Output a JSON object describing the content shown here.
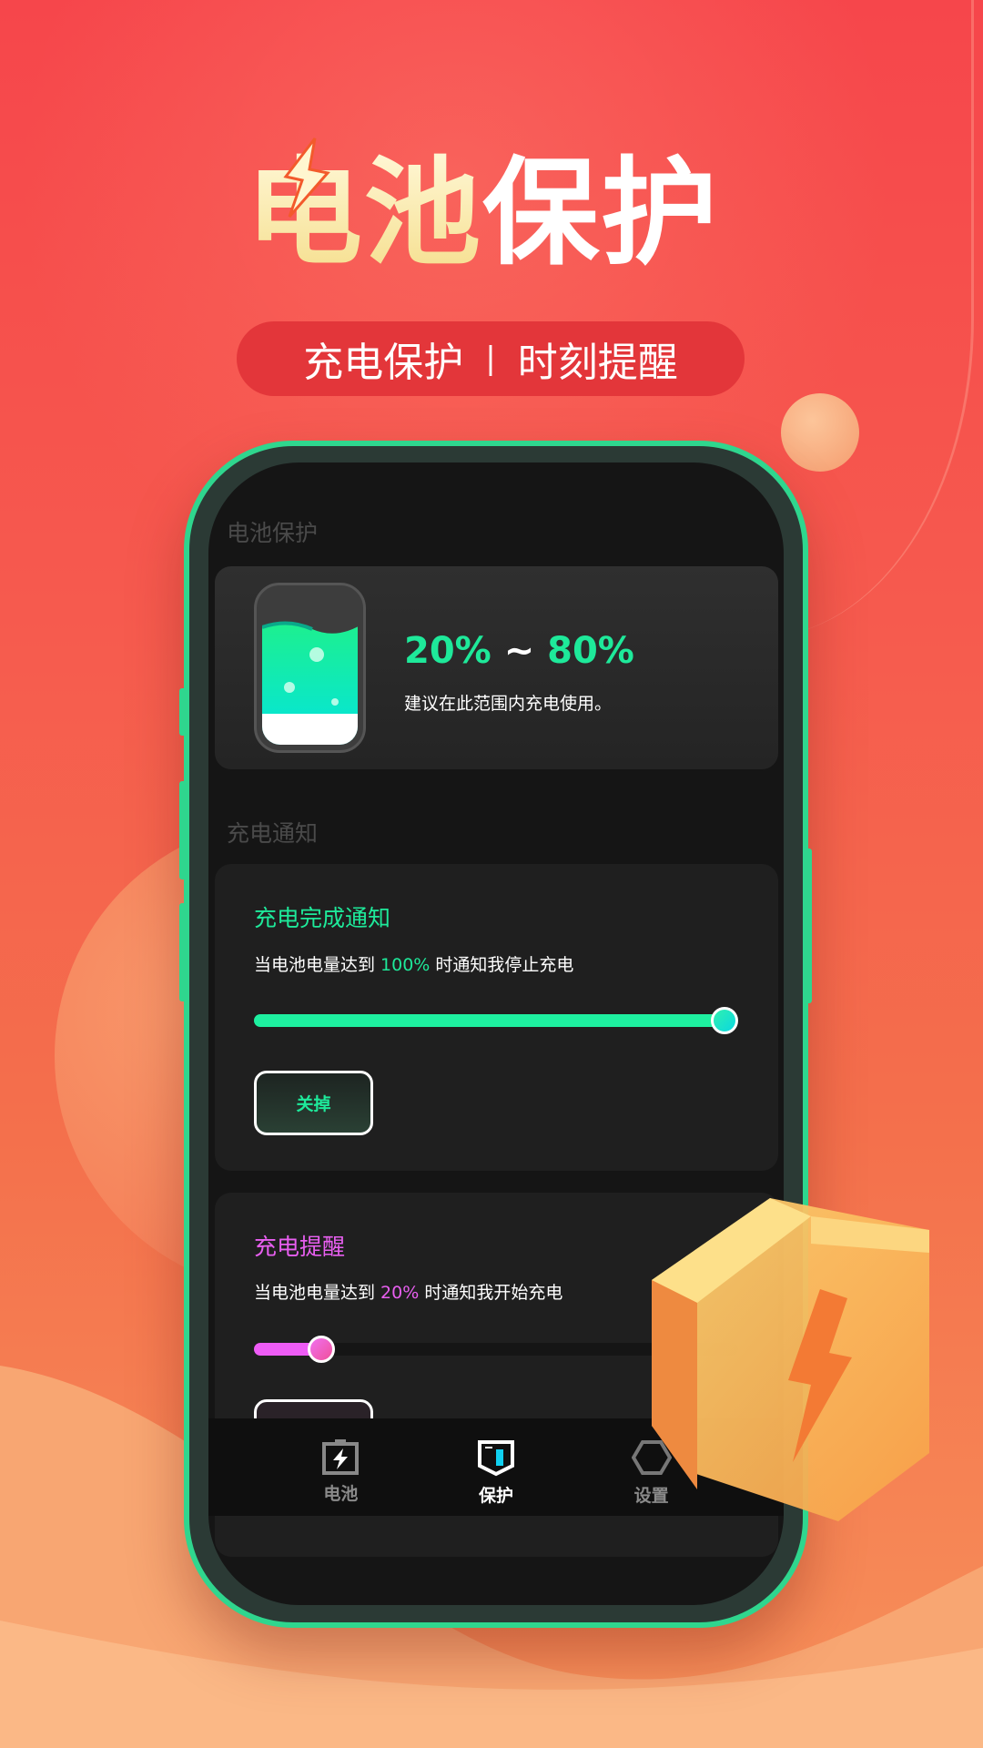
{
  "hero": {
    "title_part1": "电池",
    "title_part2": "保护",
    "tagline_left": "充电保护",
    "tagline_sep": "|",
    "tagline_right": "时刻提醒"
  },
  "colors": {
    "accent_green": "#1ee99a",
    "accent_pink": "#e85ff0",
    "frame_green": "#2fd68e",
    "background_red": "#f6464b"
  },
  "screen": {
    "battery_section": {
      "label": "电池保护",
      "range_low": "20%",
      "range_sep": "~",
      "range_high": "80%",
      "range_suffix": "%",
      "hint": "建议在此范围内充电使用。"
    },
    "notify_section": {
      "label": "充电通知"
    },
    "full_notice": {
      "title": "充电完成通知",
      "desc_prefix": "当电池电量达到 ",
      "value": "100%",
      "desc_suffix": " 时通知我停止充电",
      "slider_percent": 100,
      "button": "关掉"
    },
    "reminder": {
      "title": "充电提醒",
      "desc_prefix": "当电池电量达到 ",
      "value": "20%",
      "desc_suffix": " 时通知我开始充电",
      "slider_percent": 20
    },
    "nav": [
      {
        "label": "电池",
        "icon": "battery-charge-icon",
        "active": false
      },
      {
        "label": "保护",
        "icon": "shield-icon",
        "active": true
      },
      {
        "label": "设置",
        "icon": "settings-hexagon-icon",
        "active": false
      }
    ]
  }
}
